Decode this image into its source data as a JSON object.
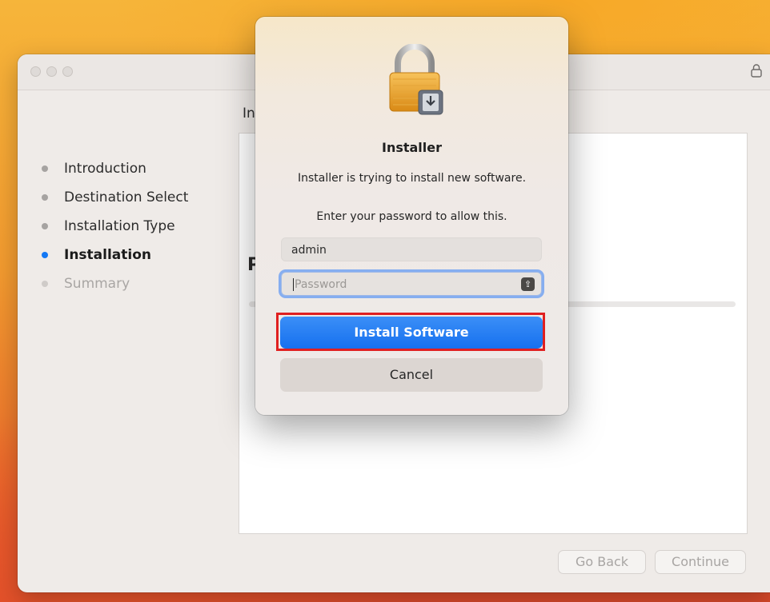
{
  "window": {
    "lock_glyph": "🔒",
    "content_heading": "In",
    "content_big": "P"
  },
  "steps": [
    {
      "label": "Introduction",
      "state": "done"
    },
    {
      "label": "Destination Select",
      "state": "done"
    },
    {
      "label": "Installation Type",
      "state": "done"
    },
    {
      "label": "Installation",
      "state": "active"
    },
    {
      "label": "Summary",
      "state": "disabled"
    }
  ],
  "buttons": {
    "go_back": "Go Back",
    "continue": "Continue"
  },
  "dialog": {
    "title": "Installer",
    "message": "Installer is trying to install new software.",
    "prompt": "Enter your password to allow this.",
    "username_value": "admin",
    "password_placeholder": "Password",
    "install_label": "Install Software",
    "cancel_label": "Cancel"
  },
  "colors": {
    "accent": "#1670ef",
    "highlight": "#e02020"
  }
}
